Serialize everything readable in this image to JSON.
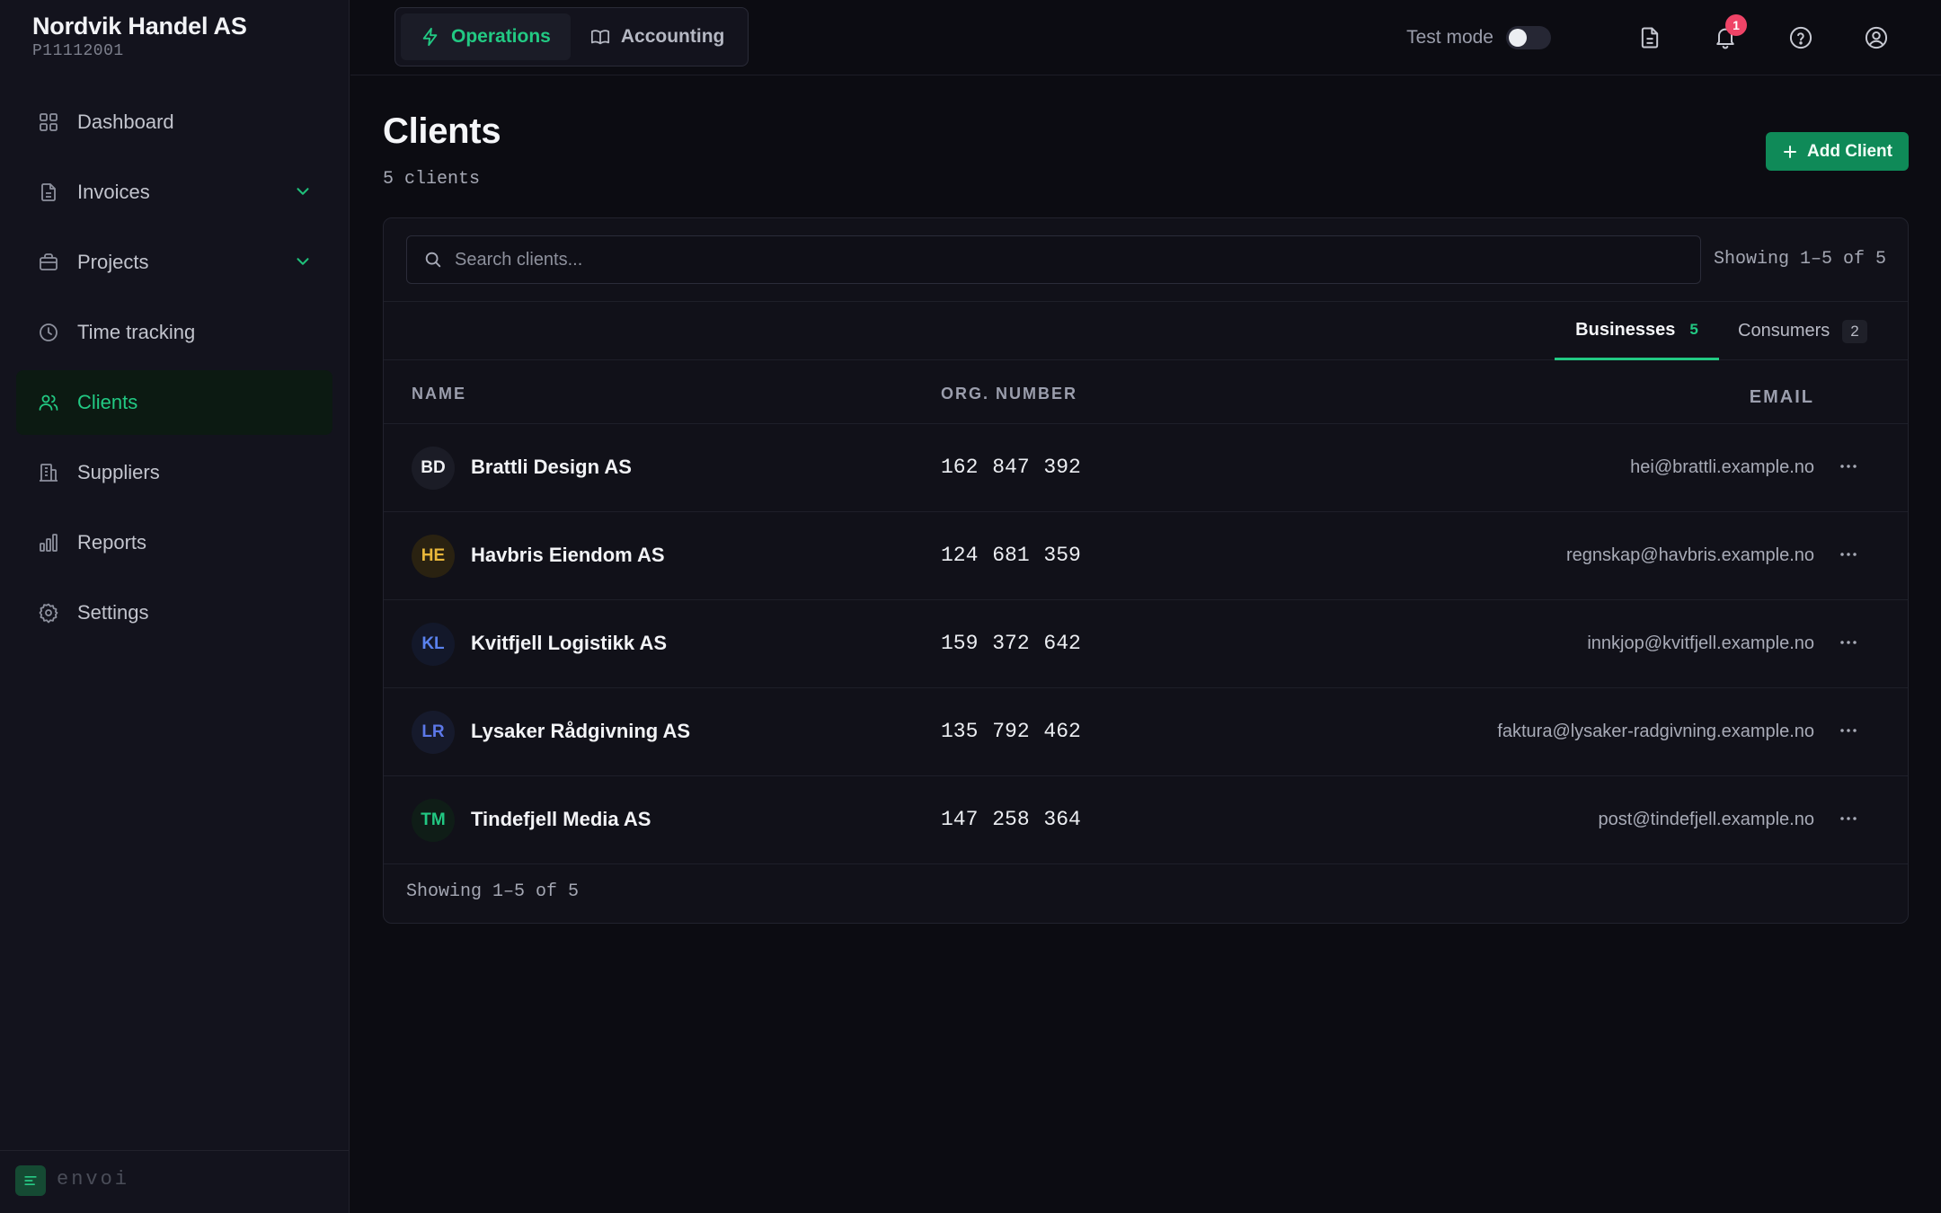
{
  "brand": {
    "name": "Nordvik Handel AS",
    "id": "P11112001"
  },
  "sidebar": {
    "items": [
      {
        "label": "Dashboard",
        "icon": "dashboard-icon"
      },
      {
        "label": "Invoices",
        "icon": "file-icon",
        "expandable": true
      },
      {
        "label": "Projects",
        "icon": "briefcase-icon",
        "expandable": true
      },
      {
        "label": "Time tracking",
        "icon": "clock-icon"
      },
      {
        "label": "Clients",
        "icon": "users-icon",
        "active": true
      },
      {
        "label": "Suppliers",
        "icon": "building-icon"
      },
      {
        "label": "Reports",
        "icon": "bar-chart-icon"
      },
      {
        "label": "Settings",
        "icon": "gear-icon"
      }
    ],
    "footer_logo_text": "envoi"
  },
  "topbar": {
    "modes": [
      {
        "label": "Operations",
        "icon": "lightning-icon",
        "active": true
      },
      {
        "label": "Accounting",
        "icon": "book-icon",
        "active": false
      }
    ],
    "test_mode_label": "Test mode",
    "test_mode_on": false,
    "notification_count": "1"
  },
  "page": {
    "title": "Clients",
    "subtitle": "5 clients",
    "add_button": "Add Client"
  },
  "search": {
    "placeholder": "Search clients..."
  },
  "showing_top": "Showing 1–5 of 5",
  "showing_bottom": "Showing 1–5 of 5",
  "tabs": {
    "businesses": {
      "label": "Businesses",
      "count": "5"
    },
    "consumers": {
      "label": "Consumers",
      "count": "2"
    }
  },
  "table": {
    "columns": {
      "name": "NAME",
      "org": "ORG. NUMBER",
      "email": "EMAIL"
    },
    "rows": [
      {
        "initials": "BD",
        "name": "Brattli Design AS",
        "org": "162 847 392",
        "email": "hei@brattli.example.no",
        "avatar_bg": "#1b1c26",
        "avatar_fg": "#f0f1f5"
      },
      {
        "initials": "HE",
        "name": "Havbris Eiendom AS",
        "org": "124 681 359",
        "email": "regnskap@havbris.example.no",
        "avatar_bg": "#2a2211",
        "avatar_fg": "#e8b73a"
      },
      {
        "initials": "KL",
        "name": "Kvitfjell Logistikk AS",
        "org": "159 372 642",
        "email": "innkjop@kvitfjell.example.no",
        "avatar_bg": "#13182a",
        "avatar_fg": "#5a82ee"
      },
      {
        "initials": "LR",
        "name": "Lysaker Rådgivning AS",
        "org": "135 792 462",
        "email": "faktura@lysaker-radgivning.example.no",
        "avatar_bg": "#161a2c",
        "avatar_fg": "#5c78e8"
      },
      {
        "initials": "TM",
        "name": "Tindefjell Media AS",
        "org": "147 258 364",
        "email": "post@tindefjell.example.no",
        "avatar_bg": "#0f1d17",
        "avatar_fg": "#22c983"
      }
    ]
  },
  "colors": {
    "accent": "#22c983",
    "button_bg": "#0f8a58",
    "badge": "#ef4467",
    "background": "#0c0c12",
    "sidebar": "#13131d"
  }
}
